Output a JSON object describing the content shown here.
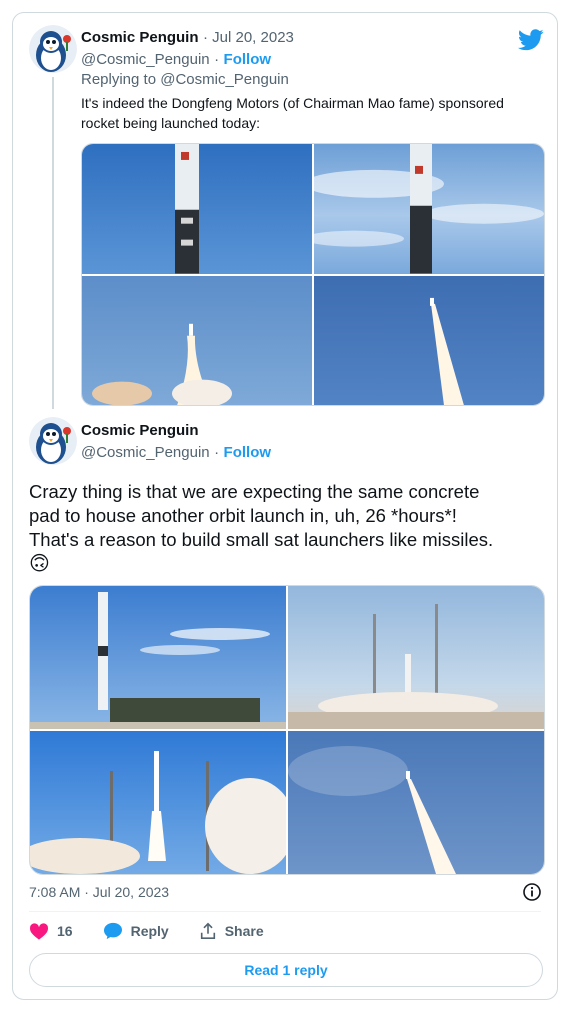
{
  "reply_tweet": {
    "author_name": "Cosmic Penguin",
    "date": "· Jul 20, 2023",
    "handle": "@Cosmic_Penguin",
    "follow_label": "Follow",
    "replying_to": "Replying to @Cosmic_Penguin",
    "text_line1": "It's indeed the Dongfeng Motors (of Chairman Mao fame) sponsored",
    "text_line2": "rocket being launched today:"
  },
  "main_tweet": {
    "author_name": "Cosmic Penguin",
    "handle": "@Cosmic_Penguin",
    "follow_label": "Follow",
    "text_line1": "Crazy thing is that we are expecting the same concrete",
    "text_line2": "pad to house another orbit launch in, uh, 26 *hours*!",
    "text_line3": "That's a reason to build small sat launchers like missiles.",
    "emoji": "🙃",
    "timestamp": "7:08 AM · Jul 20, 2023",
    "like_count": "16",
    "reply_label": "Reply",
    "share_label": "Share",
    "read_replies_label": "Read 1 reply"
  },
  "icons": [
    "twitter-bird-icon",
    "info-icon",
    "heart-icon",
    "reply-icon",
    "share-icon"
  ],
  "colors": {
    "accent": "#1d9bf0",
    "like": "#f91880",
    "text": "#0f1419",
    "muted": "#536471",
    "border": "#cfd9de"
  }
}
